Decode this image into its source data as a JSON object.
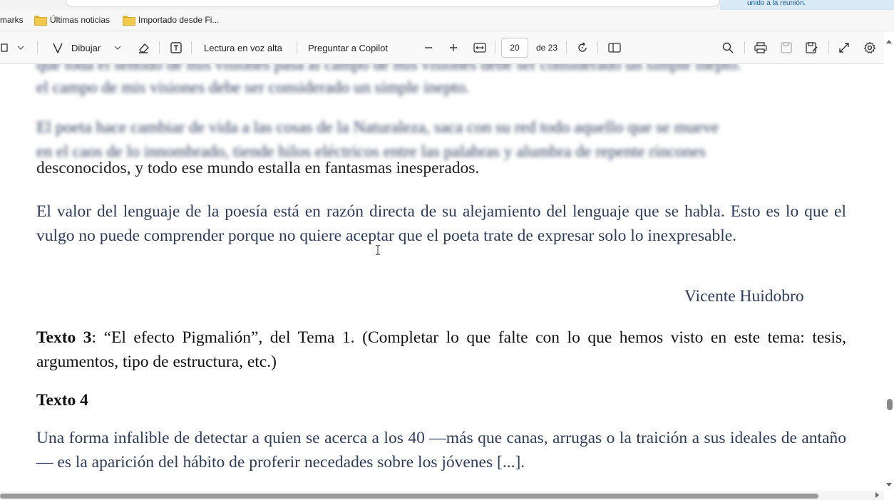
{
  "notification": {
    "text": "unido a la reunión."
  },
  "bookmarks": {
    "items": [
      {
        "label": "marks"
      },
      {
        "label": "Últimas noticias"
      },
      {
        "label": "Importado desde Fi..."
      }
    ]
  },
  "toolbar": {
    "draw_label": "Dibujar",
    "read_aloud_label": "Lectura en voz alta",
    "copilot_label": "Preguntar a Copilot",
    "current_page": "20",
    "page_total": "de 23"
  },
  "document": {
    "blurred_top_1": "que toda el sentido de mis visiones pasa al campo de mis visiones debe ser considerado un simple inepto.",
    "blurred_top_2": "el campo de mis visiones debe ser considerado un simple inepto.",
    "blurred_para_1": "El poeta hace cambiar de vida a las cosas de la Naturaleza, saca con su red todo aquello que se mueve",
    "blurred_para_2": "en el caos de lo innombrado, tiende hilos eléctricos entre las palabras y alumbra de repente rincones",
    "partial_line": "desconocidos, y todo ese mundo estalla en fantasmas inesperados.",
    "valor_paragraph": "El valor del lenguaje de la poesía está en razón directa de su alejamiento del lenguaje que se habla. Esto es lo que el vulgo no puede comprender porque no quiere aceptar que el poeta trate de expresar solo lo inexpresable.",
    "author": "Vicente Huidobro",
    "texto3_heading": "Texto 3",
    "texto3_body": ": “El efecto Pigmalión”, del Tema 1. (Completar lo que falte con lo que hemos visto en este tema: tesis, argumentos, tipo de estructura, etc.)",
    "texto4_heading": "Texto 4",
    "texto4_body": "Una forma infalible de detectar a quien se acerca a los 40 —más que canas, arrugas o la traición a sus ideales de antaño— es la aparición del hábito de proferir necedades sobre los jóvenes [...]."
  }
}
